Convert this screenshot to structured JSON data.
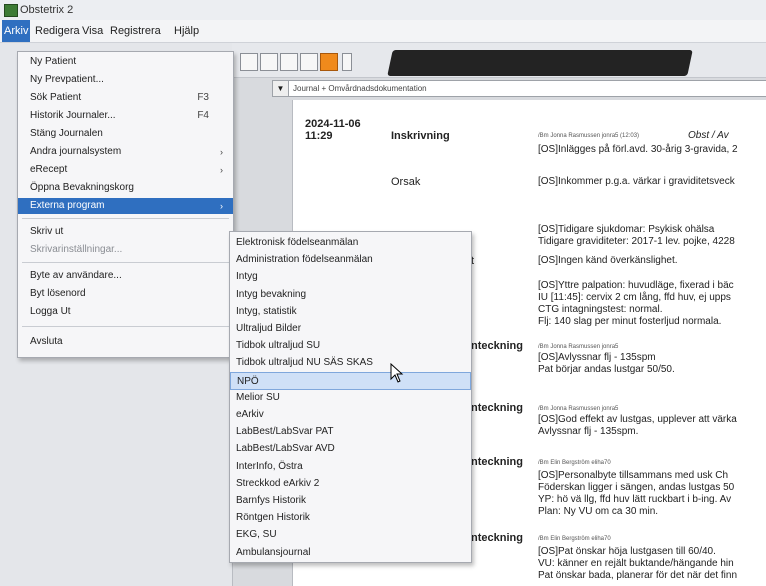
{
  "window": {
    "title": "Obstetrix 2"
  },
  "menubar": {
    "items": [
      "Arkiv",
      "Redigera",
      "Visa",
      "Registrera",
      "Hjälp"
    ],
    "active": "Arkiv"
  },
  "toolbar": {
    "dropdown_value": "Journal + Omvårdnadsdokumentation"
  },
  "arkiv_menu": {
    "items": [
      {
        "label": "Ny Patient"
      },
      {
        "label": "Ny Prevpatient..."
      },
      {
        "label": "Sök Patient",
        "shortcut": "F3"
      },
      {
        "label": "Historik Journaler...",
        "shortcut": "F4"
      },
      {
        "label": "Stäng Journalen"
      },
      {
        "label": "Andra journalsystem",
        "arrow": "›"
      },
      {
        "label": "eRecept",
        "arrow": "›"
      },
      {
        "label": "Öppna Bevakningskorg"
      },
      {
        "label": "Externa program",
        "arrow": "›"
      },
      {
        "label": "Skriv ut"
      },
      {
        "label": "Skrivarinställningar..."
      },
      {
        "label": "Byte av användare..."
      },
      {
        "label": "Byt lösenord"
      },
      {
        "label": "Logga Ut"
      },
      {
        "label": "Avsluta"
      }
    ]
  },
  "external_menu": {
    "items": [
      "Elektronisk födelseanmälan",
      "Administration födelseanmälan",
      "Intyg",
      "Intyg bevakning",
      "Intyg, statistik",
      "Ultraljud Bilder",
      "Tidbok ultraljud SU",
      "Tidbok ultraljud NU SÄS SKAS",
      "NPÖ",
      "Melior SU",
      "eArkiv",
      "LabBest/LabSvar PAT",
      "LabBest/LabSvar AVD",
      "InterInfo, Östra",
      "Streckkod eArkiv 2",
      "Barnfys Historik",
      "Röntgen Historik",
      "EKG, SU",
      "Ambulansjournal"
    ],
    "highlighted": "NPÖ"
  },
  "journal": {
    "date": "2024-11-06",
    "time": "11:29",
    "heading": "Inskrivning",
    "author1": "/Bm Jonna Rasmussen jonra5 (12:03)",
    "author1_tail": "Obst / Av",
    "line1": "[OS]Inlägges på förl.avd. 30-årig 3-gravida, 2",
    "orsak_label": "Orsak",
    "orsak_text": "[OS]Inkommer p.g.a. värkar i graviditetsveck",
    "line_anamnes1": "[OS]Tidigare sjukdomar: Psykisk ohälsa",
    "line_anamnes2": "Tidigare graviditeter: 2017-1 lev. pojke, 4228",
    "t_fragment": "t",
    "line_overk": "[OS]Ingen känd överkänslighet.",
    "status1": "[OS]Yttre palpation: huvudläge, fixerad i bäc",
    "status2": "IU [11:45]: cervix 2 cm lång, ffd huv, ej upps",
    "status3": "CTG intagningstest: normal.",
    "status4": "Flj: 140 slag per minut fosterljud normala.",
    "note_heading": "nteckning",
    "note1_author": "/Bm Jonna Rasmussen jonra5",
    "note1_l1": "[OS]Avlyssnar flj - 135spm",
    "note1_l2": "Pat börjar andas lustgar 50/50.",
    "note2_author": "/Bm Jonna Rasmussen jonra5",
    "note2_l1": "[OS]God effekt av lustgas, upplever att värka",
    "note2_l2": "Avlyssnar flj - 135spm.",
    "note3_author": "/Bm Elin Bergström eliha70",
    "note3_l1": "[OS]Personalbyte tillsammans med usk Ch",
    "note3_l2": "Föderskan ligger i sängen, andas lustgas 50",
    "note3_l3": "YP: hö vä llg, ffd huv lätt ruckbart i b-ing. Av",
    "note3_l4": "Plan: Ny VU om ca 30 min.",
    "note4_author": "/Bm Elin Bergström eliha70",
    "note4_l1": "[OS]Pat önskar höja lustgasen till 60/40.",
    "note4_l2": "VU: känner en rejält buktande/hängande hin",
    "note4_l3": "Pat önskar bada, planerar för det när det finn"
  }
}
